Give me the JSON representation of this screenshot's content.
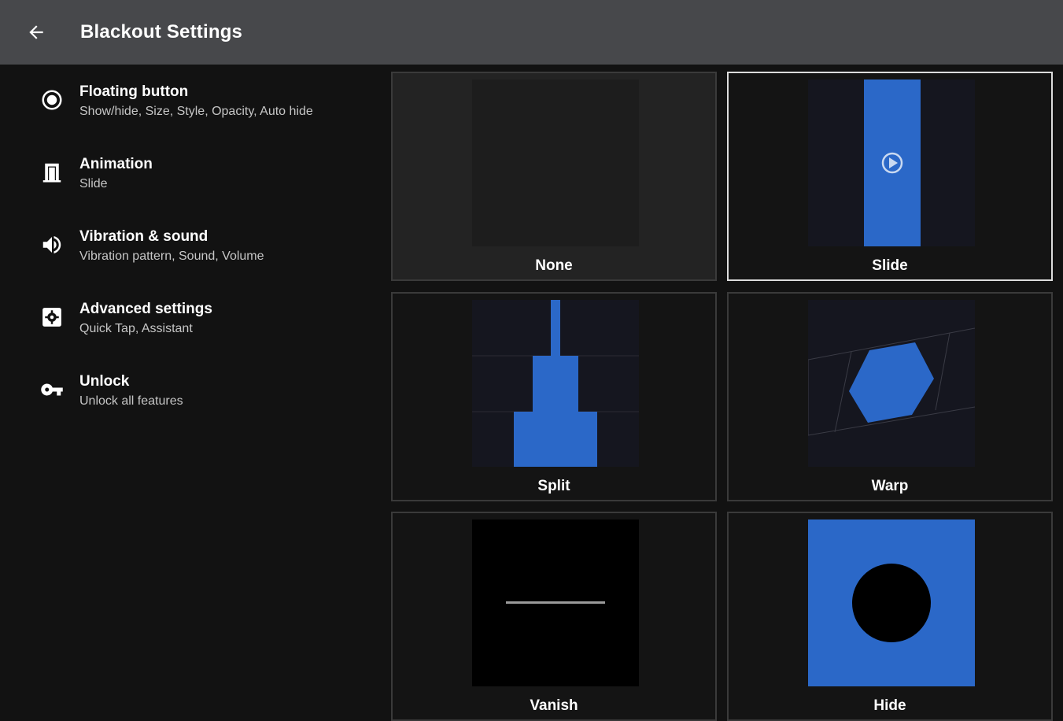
{
  "header": {
    "title": "Blackout Settings",
    "back_icon": "arrow-left-icon"
  },
  "menu": [
    {
      "title": "Floating button",
      "subtitle": "Show/hide, Size, Style, Opacity, Auto hide",
      "icon": "radio-button-icon"
    },
    {
      "title": "Animation",
      "subtitle": "Slide",
      "icon": "door-icon"
    },
    {
      "title": "Vibration & sound",
      "subtitle": "Vibration pattern, Sound, Volume",
      "icon": "volume-icon"
    },
    {
      "title": "Advanced settings",
      "subtitle": "Quick Tap, Assistant",
      "icon": "settings-box-icon"
    },
    {
      "title": "Unlock",
      "subtitle": "Unlock all features",
      "icon": "key-icon"
    }
  ],
  "animations": {
    "selected": "Slide",
    "options": [
      {
        "label": "None"
      },
      {
        "label": "Slide"
      },
      {
        "label": "Split"
      },
      {
        "label": "Warp"
      },
      {
        "label": "Vanish"
      },
      {
        "label": "Hide"
      }
    ]
  },
  "colors": {
    "appbar": "#47484b",
    "background": "#121212",
    "accent": "#2b68c8",
    "selected_border": "#dcdcdc"
  }
}
